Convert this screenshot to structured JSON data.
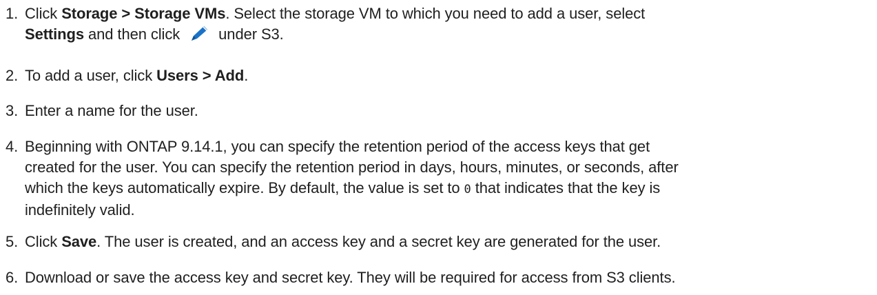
{
  "steps": [
    {
      "number": "1.",
      "t1": "Click ",
      "b1": "Storage > Storage VMs",
      "t2": ". Select the storage VM to which you need to add a user, select",
      "b2": "Settings",
      "t3": " and then click ",
      "t4": " under S3.",
      "icon": "pencil-edit-icon"
    },
    {
      "number": "2.",
      "t1": "To add a user, click ",
      "b1": "Users > Add",
      "t2": "."
    },
    {
      "number": "3.",
      "t1": "Enter a name for the user."
    },
    {
      "number": "4.",
      "line1": "Beginning with ONTAP 9.14.1, you can specify the retention period of the access keys that get",
      "line2": "created for the user. You can specify the retention period in days, hours, minutes, or seconds, after",
      "line3a": "which the keys automatically expire. By default, the value is set to ",
      "code": "0",
      "line3b": " that indicates that the key is",
      "line4": "indefinitely valid."
    },
    {
      "number": "5.",
      "t1": "Click ",
      "b1": "Save",
      "t2": ". The user is created, and an access key and a secret key are generated for the user."
    },
    {
      "number": "6.",
      "t1": "Download or save the access key and secret key. They will be required for access from S3 clients."
    }
  ],
  "colors": {
    "text": "#1f1f1f",
    "icon": "#1a73c8"
  }
}
